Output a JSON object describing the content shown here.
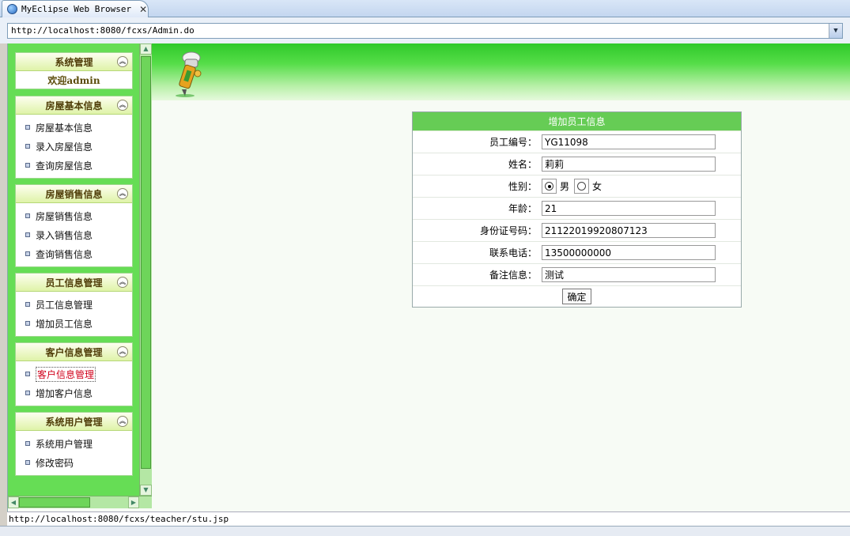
{
  "tab": {
    "title": "MyEclipse Web Browser",
    "close": "✕"
  },
  "address": {
    "url": "http://localhost:8080/fcxs/Admin.do"
  },
  "status": {
    "text": "http://localhost:8080/fcxs/teacher/stu.jsp"
  },
  "sidebar": {
    "system": {
      "title": "系统管理",
      "welcome": "欢迎admin"
    },
    "panels": [
      {
        "title": "房屋基本信息",
        "items": [
          "房屋基本信息",
          "录入房屋信息",
          "查询房屋信息"
        ]
      },
      {
        "title": "房屋销售信息",
        "items": [
          "房屋销售信息",
          "录入销售信息",
          "查询销售信息"
        ]
      },
      {
        "title": "员工信息管理",
        "items": [
          "员工信息管理",
          "增加员工信息"
        ]
      },
      {
        "title": "客户信息管理",
        "items": [
          "客户信息管理",
          "增加客户信息"
        ]
      },
      {
        "title": "系统用户管理",
        "items": [
          "系统用户管理",
          "修改密码"
        ]
      }
    ]
  },
  "form": {
    "title": "增加员工信息",
    "fields": {
      "id": {
        "label": "员工编号：",
        "value": "YG11098"
      },
      "name": {
        "label": "姓名：",
        "value": "莉莉"
      },
      "gender": {
        "label": "性别：",
        "male": "男",
        "female": "女",
        "selected": "男"
      },
      "age": {
        "label": "年龄：",
        "value": "21"
      },
      "idcard": {
        "label": "身份证号码：",
        "value": "21122019920807123"
      },
      "phone": {
        "label": "联系电话：",
        "value": "13500000000"
      },
      "remark": {
        "label": "备注信息：",
        "value": "测试"
      }
    },
    "submit": "确定"
  },
  "colors": {
    "sidebar_green": "#66dd55",
    "header_green": "#66cc55",
    "active_link": "#d0021b"
  },
  "icons": {
    "tab": "globe-icon",
    "collapse": "chevron-up-double-icon",
    "bullet": "square-bullet-icon",
    "mascot": "pencil-mascot-icon"
  }
}
